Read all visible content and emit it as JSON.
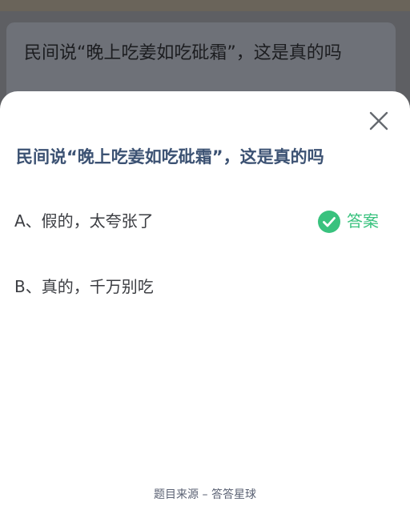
{
  "background": {
    "question_text": "民间说“晚上吃姜如吃砒霜”，这是真的吗"
  },
  "sheet": {
    "title": "民间说“晚上吃姜如吃砒霜”，这是真的吗",
    "options": [
      {
        "text": "A、假的，太夸张了",
        "is_answer": true
      },
      {
        "text": "B、真的，千万别吃",
        "is_answer": false
      }
    ],
    "answer_label": "答案",
    "footer": "题目来源 – 答答星球"
  },
  "icons": {
    "close": "close-icon",
    "check": "check-circle-icon"
  },
  "colors": {
    "title": "#3c5273",
    "answer_green": "#39c27e",
    "sheet_background": "#ffffff",
    "overlay": "#5e5f63"
  }
}
